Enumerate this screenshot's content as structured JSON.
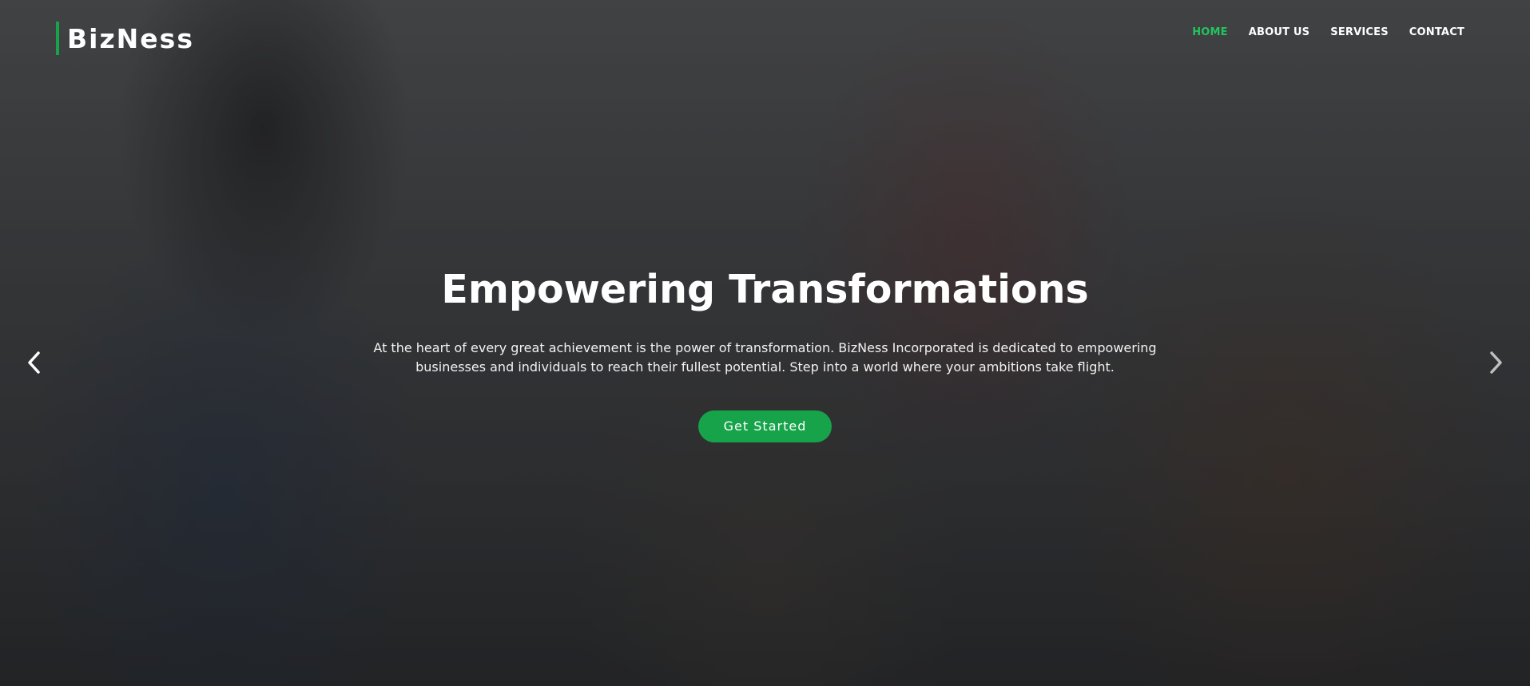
{
  "brand": {
    "name": "BizNess",
    "accent_color": "#16a34a"
  },
  "nav": {
    "items": [
      {
        "label": "HOME",
        "active": true
      },
      {
        "label": "ABOUT US",
        "active": false
      },
      {
        "label": "SERVICES",
        "active": false
      },
      {
        "label": "CONTACT",
        "active": false
      }
    ],
    "active_color": "#22c55e"
  },
  "hero": {
    "title": "Empowering Transformations",
    "description": "At the heart of every great achievement is the power of transformation. BizNess Incorporated is dedicated to empowering businesses and individuals to reach their fullest potential. Step into a world where your ambitions take flight.",
    "cta_label": "Get Started",
    "background_image": "team meeting photo"
  },
  "carousel": {
    "prev_icon": "chevron-left-icon",
    "next_icon": "chevron-right-icon"
  }
}
